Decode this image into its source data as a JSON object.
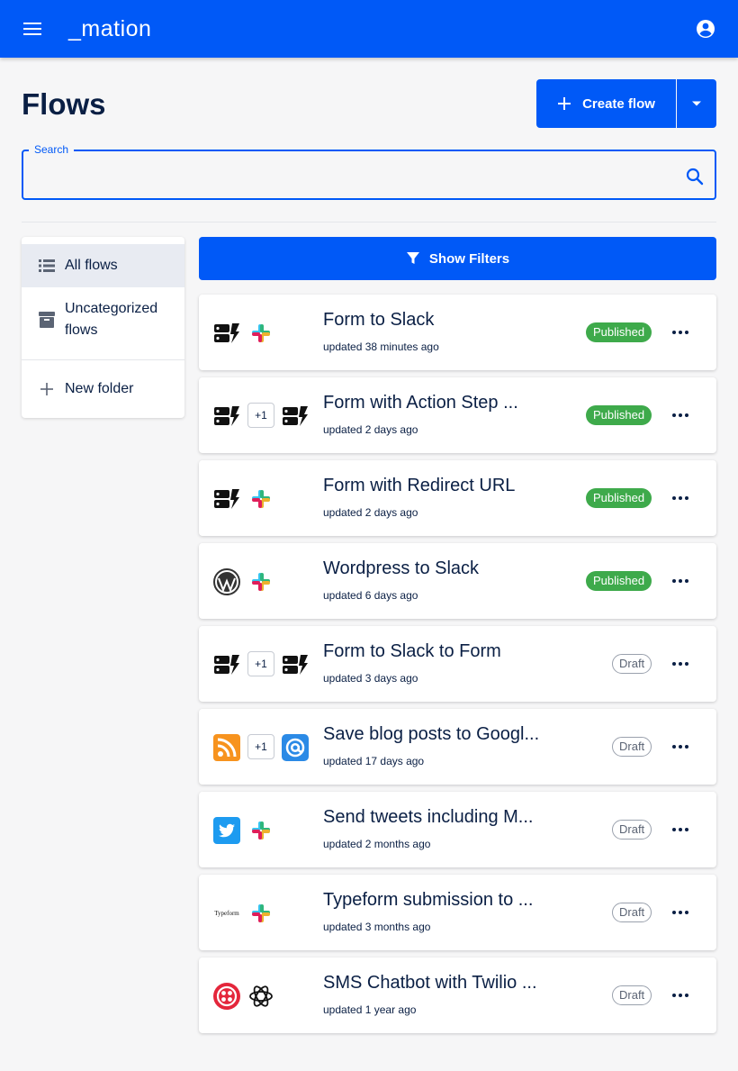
{
  "app": {
    "logo_text": "_mation",
    "brand_color": "#0059f7"
  },
  "header": {
    "title": "Flows",
    "create_label": "Create flow"
  },
  "search": {
    "legend": "Search",
    "value": "",
    "placeholder": ""
  },
  "sidebar": {
    "items": [
      {
        "label": "All flows",
        "icon": "list-icon",
        "active": true
      },
      {
        "label": "Uncategorized flows",
        "icon": "archive-icon",
        "active": false
      },
      {
        "label": "New folder",
        "icon": "plus-icon",
        "active": false
      }
    ]
  },
  "filters": {
    "label": "Show Filters"
  },
  "flows": [
    {
      "title": "Form to Slack",
      "updated": "updated 38 minutes ago",
      "status": "Published",
      "apps": [
        "formbot-icon",
        "slack-icon"
      ],
      "extra": ""
    },
    {
      "title": "Form with Action Step ...",
      "updated": "updated 2 days ago",
      "status": "Published",
      "apps": [
        "formbot-icon",
        "formbot-icon"
      ],
      "extra": "+1"
    },
    {
      "title": "Form with Redirect URL",
      "updated": "updated 2 days ago",
      "status": "Published",
      "apps": [
        "formbot-icon",
        "slack-icon"
      ],
      "extra": ""
    },
    {
      "title": "Wordpress to Slack",
      "updated": "updated 6 days ago",
      "status": "Published",
      "apps": [
        "wordpress-icon",
        "slack-icon"
      ],
      "extra": ""
    },
    {
      "title": "Form to Slack to Form",
      "updated": "updated 3 days ago",
      "status": "Draft",
      "apps": [
        "formbot-icon",
        "formbot-icon"
      ],
      "extra": "+1"
    },
    {
      "title": "Save blog posts to Googl...",
      "updated": "updated 17 days ago",
      "status": "Draft",
      "apps": [
        "rss-icon",
        "email-icon"
      ],
      "extra": "+1"
    },
    {
      "title": "Send tweets including M...",
      "updated": "updated 2 months ago",
      "status": "Draft",
      "apps": [
        "twitter-icon",
        "slack-icon"
      ],
      "extra": ""
    },
    {
      "title": "Typeform submission to ...",
      "updated": "updated 3 months ago",
      "status": "Draft",
      "apps": [
        "typeform-icon",
        "slack-icon"
      ],
      "extra": "",
      "typeform_text": "Typeform"
    },
    {
      "title": "SMS Chatbot with Twilio ...",
      "updated": "updated 1 year ago",
      "status": "Draft",
      "apps": [
        "twilio-icon",
        "openai-icon"
      ],
      "extra": ""
    }
  ],
  "colors": {
    "published": "#3eaa4b",
    "draft_border": "#9aa1ad",
    "text": "#0a1f44"
  }
}
